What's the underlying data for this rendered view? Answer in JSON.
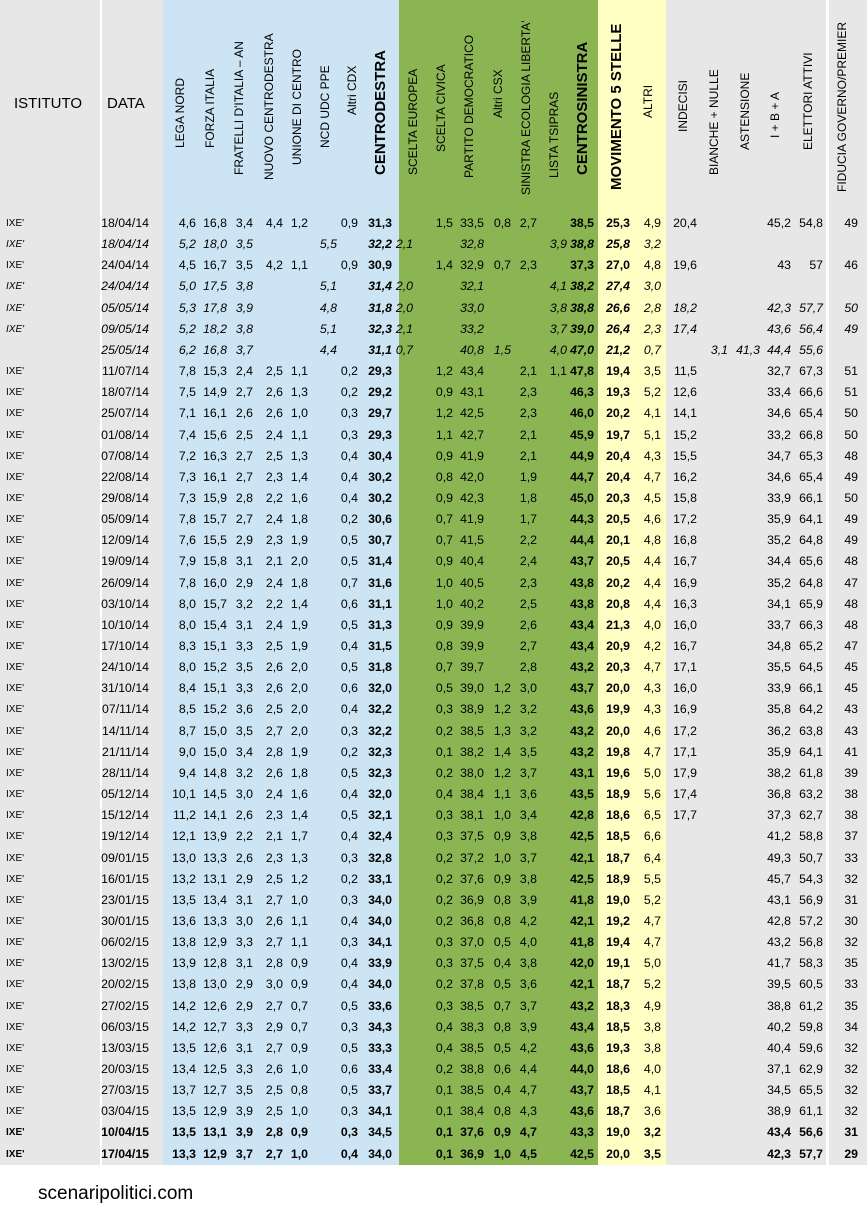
{
  "header": {
    "istituto": "ISTITUTO",
    "data": "DATA",
    "columns": [
      "LEGA NORD",
      "FORZA ITALIA",
      "FRATELLI D'ITALIA – AN",
      "NUOVO CENTRODESTRA",
      "UNIONE DI CENTRO",
      "NCD UDC PPE",
      "Altri CDX",
      "CENTRODESTRA",
      "SCELTA EUROPEA",
      "SCELTA CIVICA",
      "PARTITO DEMOCRATICO",
      "Altri CSX",
      "SINISTRA ECOLOGIA LIBERTA'",
      "LISTA TSIPRAS",
      "CENTROSINISTRA",
      "MOVIMENTO 5 STELLE",
      "ALTRI",
      "INDECISI",
      "BIANCHE + NULLE",
      "ASTENSIONE",
      "I + B + A",
      "ELETTORI ATTIVI",
      "FIDUCIA GOVERNO/PREMIER"
    ]
  },
  "colors": {
    "cdx_band": "#cce4f3",
    "csx_band": "#8ab552",
    "m5s_band": "#ffffc4",
    "grey_band": "#e7e7e7"
  },
  "rows": [
    {
      "s": "n",
      "v": [
        "IXE'",
        "18/04/14",
        "4,6",
        "16,8",
        "3,4",
        "4,4",
        "1,2",
        "",
        "0,9",
        "31,3",
        "",
        "1,5",
        "33,5",
        "0,8",
        "2,7",
        "",
        "38,5",
        "25,3",
        "4,9",
        "20,4",
        "",
        "",
        "45,2",
        "54,8",
        "49"
      ]
    },
    {
      "s": "i",
      "v": [
        "IXE'",
        "18/04/14",
        "5,2",
        "18,0",
        "3,5",
        "",
        "",
        "5,5",
        "",
        "32,2",
        "2,1",
        "",
        "32,8",
        "",
        "",
        "3,9",
        "38,8",
        "25,8",
        "3,2",
        "",
        "",
        "",
        "",
        "",
        ""
      ]
    },
    {
      "s": "n",
      "v": [
        "IXE'",
        "24/04/14",
        "4,5",
        "16,7",
        "3,5",
        "4,2",
        "1,1",
        "",
        "0,9",
        "30,9",
        "",
        "1,4",
        "32,9",
        "0,7",
        "2,3",
        "",
        "37,3",
        "27,0",
        "4,8",
        "19,6",
        "",
        "",
        "43",
        "57",
        "46"
      ]
    },
    {
      "s": "i",
      "v": [
        "IXE'",
        "24/04/14",
        "5,0",
        "17,5",
        "3,8",
        "",
        "",
        "5,1",
        "",
        "31,4",
        "2,0",
        "",
        "32,1",
        "",
        "",
        "4,1",
        "38,2",
        "27,4",
        "3,0",
        "",
        "",
        "",
        "",
        "",
        ""
      ]
    },
    {
      "s": "i",
      "v": [
        "IXE'",
        "05/05/14",
        "5,3",
        "17,8",
        "3,9",
        "",
        "",
        "4,8",
        "",
        "31,8",
        "2,0",
        "",
        "33,0",
        "",
        "",
        "3,8",
        "38,8",
        "26,6",
        "2,8",
        "18,2",
        "",
        "",
        "42,3",
        "57,7",
        "50"
      ]
    },
    {
      "s": "i",
      "v": [
        "IXE'",
        "09/05/14",
        "5,2",
        "18,2",
        "3,8",
        "",
        "",
        "5,1",
        "",
        "32,3",
        "2,1",
        "",
        "33,2",
        "",
        "",
        "3,7",
        "39,0",
        "26,4",
        "2,3",
        "17,4",
        "",
        "",
        "43,6",
        "56,4",
        "49"
      ]
    },
    {
      "s": "i",
      "v": [
        "",
        "25/05/14",
        "6,2",
        "16,8",
        "3,7",
        "",
        "",
        "4,4",
        "",
        "31,1",
        "0,7",
        "",
        "40,8",
        "1,5",
        "",
        "4,0",
        "47,0",
        "21,2",
        "0,7",
        "",
        "3,1",
        "41,3",
        "44,4",
        "55,6",
        ""
      ]
    },
    {
      "s": "n",
      "v": [
        "IXE'",
        "11/07/14",
        "7,8",
        "15,3",
        "2,4",
        "2,5",
        "1,1",
        "",
        "0,2",
        "29,3",
        "",
        "1,2",
        "43,4",
        "",
        "2,1",
        "1,1",
        "47,8",
        "19,4",
        "3,5",
        "11,5",
        "",
        "",
        "32,7",
        "67,3",
        "51"
      ]
    },
    {
      "s": "n",
      "v": [
        "IXE'",
        "18/07/14",
        "7,5",
        "14,9",
        "2,7",
        "2,6",
        "1,3",
        "",
        "0,2",
        "29,2",
        "",
        "0,9",
        "43,1",
        "",
        "2,3",
        "",
        "46,3",
        "19,3",
        "5,2",
        "12,6",
        "",
        "",
        "33,4",
        "66,6",
        "51"
      ]
    },
    {
      "s": "n",
      "v": [
        "IXE'",
        "25/07/14",
        "7,1",
        "16,1",
        "2,6",
        "2,6",
        "1,0",
        "",
        "0,3",
        "29,7",
        "",
        "1,2",
        "42,5",
        "",
        "2,3",
        "",
        "46,0",
        "20,2",
        "4,1",
        "14,1",
        "",
        "",
        "34,6",
        "65,4",
        "50"
      ]
    },
    {
      "s": "n",
      "v": [
        "IXE'",
        "01/08/14",
        "7,4",
        "15,6",
        "2,5",
        "2,4",
        "1,1",
        "",
        "0,3",
        "29,3",
        "",
        "1,1",
        "42,7",
        "",
        "2,1",
        "",
        "45,9",
        "19,7",
        "5,1",
        "15,2",
        "",
        "",
        "33,2",
        "66,8",
        "50"
      ]
    },
    {
      "s": "n",
      "v": [
        "IXE'",
        "07/08/14",
        "7,2",
        "16,3",
        "2,7",
        "2,5",
        "1,3",
        "",
        "0,4",
        "30,4",
        "",
        "0,9",
        "41,9",
        "",
        "2,1",
        "",
        "44,9",
        "20,4",
        "4,3",
        "15,5",
        "",
        "",
        "34,7",
        "65,3",
        "48"
      ]
    },
    {
      "s": "n",
      "v": [
        "IXE'",
        "22/08/14",
        "7,3",
        "16,1",
        "2,7",
        "2,3",
        "1,4",
        "",
        "0,4",
        "30,2",
        "",
        "0,8",
        "42,0",
        "",
        "1,9",
        "",
        "44,7",
        "20,4",
        "4,7",
        "16,2",
        "",
        "",
        "34,6",
        "65,4",
        "49"
      ]
    },
    {
      "s": "n",
      "v": [
        "IXE'",
        "29/08/14",
        "7,3",
        "15,9",
        "2,8",
        "2,2",
        "1,6",
        "",
        "0,4",
        "30,2",
        "",
        "0,9",
        "42,3",
        "",
        "1,8",
        "",
        "45,0",
        "20,3",
        "4,5",
        "15,8",
        "",
        "",
        "33,9",
        "66,1",
        "50"
      ]
    },
    {
      "s": "n",
      "v": [
        "IXE'",
        "05/09/14",
        "7,8",
        "15,7",
        "2,7",
        "2,4",
        "1,8",
        "",
        "0,2",
        "30,6",
        "",
        "0,7",
        "41,9",
        "",
        "1,7",
        "",
        "44,3",
        "20,5",
        "4,6",
        "17,2",
        "",
        "",
        "35,9",
        "64,1",
        "49"
      ]
    },
    {
      "s": "n",
      "v": [
        "IXE'",
        "12/09/14",
        "7,6",
        "15,5",
        "2,9",
        "2,3",
        "1,9",
        "",
        "0,5",
        "30,7",
        "",
        "0,7",
        "41,5",
        "",
        "2,2",
        "",
        "44,4",
        "20,1",
        "4,8",
        "16,8",
        "",
        "",
        "35,2",
        "64,8",
        "49"
      ]
    },
    {
      "s": "n",
      "v": [
        "IXE'",
        "19/09/14",
        "7,9",
        "15,8",
        "3,1",
        "2,1",
        "2,0",
        "",
        "0,5",
        "31,4",
        "",
        "0,9",
        "40,4",
        "",
        "2,4",
        "",
        "43,7",
        "20,5",
        "4,4",
        "16,7",
        "",
        "",
        "34,4",
        "65,6",
        "48"
      ]
    },
    {
      "s": "n",
      "v": [
        "IXE'",
        "26/09/14",
        "7,8",
        "16,0",
        "2,9",
        "2,4",
        "1,8",
        "",
        "0,7",
        "31,6",
        "",
        "1,0",
        "40,5",
        "",
        "2,3",
        "",
        "43,8",
        "20,2",
        "4,4",
        "16,9",
        "",
        "",
        "35,2",
        "64,8",
        "47"
      ]
    },
    {
      "s": "n",
      "v": [
        "IXE'",
        "03/10/14",
        "8,0",
        "15,7",
        "3,2",
        "2,2",
        "1,4",
        "",
        "0,6",
        "31,1",
        "",
        "1,0",
        "40,2",
        "",
        "2,5",
        "",
        "43,8",
        "20,8",
        "4,4",
        "16,3",
        "",
        "",
        "34,1",
        "65,9",
        "48"
      ]
    },
    {
      "s": "n",
      "v": [
        "IXE'",
        "10/10/14",
        "8,0",
        "15,4",
        "3,1",
        "2,4",
        "1,9",
        "",
        "0,5",
        "31,3",
        "",
        "0,9",
        "39,9",
        "",
        "2,6",
        "",
        "43,4",
        "21,3",
        "4,0",
        "16,0",
        "",
        "",
        "33,7",
        "66,3",
        "48"
      ]
    },
    {
      "s": "n",
      "v": [
        "IXE'",
        "17/10/14",
        "8,3",
        "15,1",
        "3,3",
        "2,5",
        "1,9",
        "",
        "0,4",
        "31,5",
        "",
        "0,8",
        "39,9",
        "",
        "2,7",
        "",
        "43,4",
        "20,9",
        "4,2",
        "16,7",
        "",
        "",
        "34,8",
        "65,2",
        "47"
      ]
    },
    {
      "s": "n",
      "v": [
        "IXE'",
        "24/10/14",
        "8,0",
        "15,2",
        "3,5",
        "2,6",
        "2,0",
        "",
        "0,5",
        "31,8",
        "",
        "0,7",
        "39,7",
        "",
        "2,8",
        "",
        "43,2",
        "20,3",
        "4,7",
        "17,1",
        "",
        "",
        "35,5",
        "64,5",
        "45"
      ]
    },
    {
      "s": "n",
      "v": [
        "IXE'",
        "31/10/14",
        "8,4",
        "15,1",
        "3,3",
        "2,6",
        "2,0",
        "",
        "0,6",
        "32,0",
        "",
        "0,5",
        "39,0",
        "1,2",
        "3,0",
        "",
        "43,7",
        "20,0",
        "4,3",
        "16,0",
        "",
        "",
        "33,9",
        "66,1",
        "45"
      ]
    },
    {
      "s": "n",
      "v": [
        "IXE'",
        "07/11/14",
        "8,5",
        "15,2",
        "3,6",
        "2,5",
        "2,0",
        "",
        "0,4",
        "32,2",
        "",
        "0,3",
        "38,9",
        "1,2",
        "3,2",
        "",
        "43,6",
        "19,9",
        "4,3",
        "16,9",
        "",
        "",
        "35,8",
        "64,2",
        "43"
      ]
    },
    {
      "s": "n",
      "v": [
        "IXE'",
        "14/11/14",
        "8,7",
        "15,0",
        "3,5",
        "2,7",
        "2,0",
        "",
        "0,3",
        "32,2",
        "",
        "0,2",
        "38,5",
        "1,3",
        "3,2",
        "",
        "43,2",
        "20,0",
        "4,6",
        "17,2",
        "",
        "",
        "36,2",
        "63,8",
        "43"
      ]
    },
    {
      "s": "n",
      "v": [
        "IXE'",
        "21/11/14",
        "9,0",
        "15,0",
        "3,4",
        "2,8",
        "1,9",
        "",
        "0,2",
        "32,3",
        "",
        "0,1",
        "38,2",
        "1,4",
        "3,5",
        "",
        "43,2",
        "19,8",
        "4,7",
        "17,1",
        "",
        "",
        "35,9",
        "64,1",
        "41"
      ]
    },
    {
      "s": "n",
      "v": [
        "IXE'",
        "28/11/14",
        "9,4",
        "14,8",
        "3,2",
        "2,6",
        "1,8",
        "",
        "0,5",
        "32,3",
        "",
        "0,2",
        "38,0",
        "1,2",
        "3,7",
        "",
        "43,1",
        "19,6",
        "5,0",
        "17,9",
        "",
        "",
        "38,2",
        "61,8",
        "39"
      ]
    },
    {
      "s": "n",
      "v": [
        "IXE'",
        "05/12/14",
        "10,1",
        "14,5",
        "3,0",
        "2,4",
        "1,6",
        "",
        "0,4",
        "32,0",
        "",
        "0,4",
        "38,4",
        "1,1",
        "3,6",
        "",
        "43,5",
        "18,9",
        "5,6",
        "17,4",
        "",
        "",
        "36,8",
        "63,2",
        "38"
      ]
    },
    {
      "s": "n",
      "v": [
        "IXE'",
        "15/12/14",
        "11,2",
        "14,1",
        "2,6",
        "2,3",
        "1,4",
        "",
        "0,5",
        "32,1",
        "",
        "0,3",
        "38,1",
        "1,0",
        "3,4",
        "",
        "42,8",
        "18,6",
        "6,5",
        "17,7",
        "",
        "",
        "37,3",
        "62,7",
        "38"
      ]
    },
    {
      "s": "n",
      "v": [
        "IXE'",
        "19/12/14",
        "12,1",
        "13,9",
        "2,2",
        "2,1",
        "1,7",
        "",
        "0,4",
        "32,4",
        "",
        "0,3",
        "37,5",
        "0,9",
        "3,8",
        "",
        "42,5",
        "18,5",
        "6,6",
        "",
        "",
        "",
        "41,2",
        "58,8",
        "37"
      ]
    },
    {
      "s": "n",
      "v": [
        "IXE'",
        "09/01/15",
        "13,0",
        "13,3",
        "2,6",
        "2,3",
        "1,3",
        "",
        "0,3",
        "32,8",
        "",
        "0,2",
        "37,2",
        "1,0",
        "3,7",
        "",
        "42,1",
        "18,7",
        "6,4",
        "",
        "",
        "",
        "49,3",
        "50,7",
        "33"
      ]
    },
    {
      "s": "n",
      "v": [
        "IXE'",
        "16/01/15",
        "13,2",
        "13,1",
        "2,9",
        "2,5",
        "1,2",
        "",
        "0,2",
        "33,1",
        "",
        "0,2",
        "37,6",
        "0,9",
        "3,8",
        "",
        "42,5",
        "18,9",
        "5,5",
        "",
        "",
        "",
        "45,7",
        "54,3",
        "32"
      ]
    },
    {
      "s": "n",
      "v": [
        "IXE'",
        "23/01/15",
        "13,5",
        "13,4",
        "3,1",
        "2,7",
        "1,0",
        "",
        "0,3",
        "34,0",
        "",
        "0,2",
        "36,9",
        "0,8",
        "3,9",
        "",
        "41,8",
        "19,0",
        "5,2",
        "",
        "",
        "",
        "43,1",
        "56,9",
        "31"
      ]
    },
    {
      "s": "n",
      "v": [
        "IXE'",
        "30/01/15",
        "13,6",
        "13,3",
        "3,0",
        "2,6",
        "1,1",
        "",
        "0,4",
        "34,0",
        "",
        "0,2",
        "36,8",
        "0,8",
        "4,2",
        "",
        "42,1",
        "19,2",
        "4,7",
        "",
        "",
        "",
        "42,8",
        "57,2",
        "30"
      ]
    },
    {
      "s": "n",
      "v": [
        "IXE'",
        "06/02/15",
        "13,8",
        "12,9",
        "3,3",
        "2,7",
        "1,1",
        "",
        "0,3",
        "34,1",
        "",
        "0,3",
        "37,0",
        "0,5",
        "4,0",
        "",
        "41,8",
        "19,4",
        "4,7",
        "",
        "",
        "",
        "43,2",
        "56,8",
        "32"
      ]
    },
    {
      "s": "n",
      "v": [
        "IXE'",
        "13/02/15",
        "13,9",
        "12,8",
        "3,1",
        "2,8",
        "0,9",
        "",
        "0,4",
        "33,9",
        "",
        "0,3",
        "37,5",
        "0,4",
        "3,8",
        "",
        "42,0",
        "19,1",
        "5,0",
        "",
        "",
        "",
        "41,7",
        "58,3",
        "35"
      ]
    },
    {
      "s": "n",
      "v": [
        "IXE'",
        "20/02/15",
        "13,8",
        "13,0",
        "2,9",
        "3,0",
        "0,9",
        "",
        "0,4",
        "34,0",
        "",
        "0,2",
        "37,8",
        "0,5",
        "3,6",
        "",
        "42,1",
        "18,7",
        "5,2",
        "",
        "",
        "",
        "39,5",
        "60,5",
        "33"
      ]
    },
    {
      "s": "n",
      "v": [
        "IXE'",
        "27/02/15",
        "14,2",
        "12,6",
        "2,9",
        "2,7",
        "0,7",
        "",
        "0,5",
        "33,6",
        "",
        "0,3",
        "38,5",
        "0,7",
        "3,7",
        "",
        "43,2",
        "18,3",
        "4,9",
        "",
        "",
        "",
        "38,8",
        "61,2",
        "35"
      ]
    },
    {
      "s": "n",
      "v": [
        "IXE'",
        "06/03/15",
        "14,2",
        "12,7",
        "3,3",
        "2,9",
        "0,7",
        "",
        "0,3",
        "34,3",
        "",
        "0,4",
        "38,3",
        "0,8",
        "3,9",
        "",
        "43,4",
        "18,5",
        "3,8",
        "",
        "",
        "",
        "40,2",
        "59,8",
        "34"
      ]
    },
    {
      "s": "n",
      "v": [
        "IXE'",
        "13/03/15",
        "13,5",
        "12,6",
        "3,1",
        "2,7",
        "0,9",
        "",
        "0,5",
        "33,3",
        "",
        "0,4",
        "38,5",
        "0,5",
        "4,2",
        "",
        "43,6",
        "19,3",
        "3,8",
        "",
        "",
        "",
        "40,4",
        "59,6",
        "32"
      ]
    },
    {
      "s": "n",
      "v": [
        "IXE'",
        "20/03/15",
        "13,4",
        "12,5",
        "3,3",
        "2,6",
        "1,0",
        "",
        "0,6",
        "33,4",
        "",
        "0,2",
        "38,8",
        "0,6",
        "4,4",
        "",
        "44,0",
        "18,6",
        "4,0",
        "",
        "",
        "",
        "37,1",
        "62,9",
        "32"
      ]
    },
    {
      "s": "n",
      "v": [
        "IXE'",
        "27/03/15",
        "13,7",
        "12,7",
        "3,5",
        "2,5",
        "0,8",
        "",
        "0,5",
        "33,7",
        "",
        "0,1",
        "38,5",
        "0,4",
        "4,7",
        "",
        "43,7",
        "18,5",
        "4,1",
        "",
        "",
        "",
        "34,5",
        "65,5",
        "32"
      ]
    },
    {
      "s": "n",
      "v": [
        "IXE'",
        "03/04/15",
        "13,5",
        "12,9",
        "3,9",
        "2,5",
        "1,0",
        "",
        "0,3",
        "34,1",
        "",
        "0,1",
        "38,4",
        "0,8",
        "4,3",
        "",
        "43,6",
        "18,7",
        "3,6",
        "",
        "",
        "",
        "38,9",
        "61,1",
        "32"
      ]
    },
    {
      "s": "b",
      "v": [
        "IXE'",
        "10/04/15",
        "13,5",
        "13,1",
        "3,9",
        "2,8",
        "0,9",
        "",
        "0,3",
        "34,5",
        "",
        "0,1",
        "37,6",
        "0,9",
        "4,7",
        "",
        "43,3",
        "19,0",
        "3,2",
        "",
        "",
        "",
        "43,4",
        "56,6",
        "31"
      ]
    },
    {
      "s": "b",
      "v": [
        "IXE'",
        "17/04/15",
        "13,3",
        "12,9",
        "3,7",
        "2,7",
        "1,0",
        "",
        "0,4",
        "34,0",
        "",
        "0,1",
        "36,9",
        "1,0",
        "4,5",
        "",
        "42,5",
        "20,0",
        "3,5",
        "",
        "",
        "",
        "42,3",
        "57,7",
        "29"
      ]
    }
  ],
  "footer": "scenaripolitici.com"
}
